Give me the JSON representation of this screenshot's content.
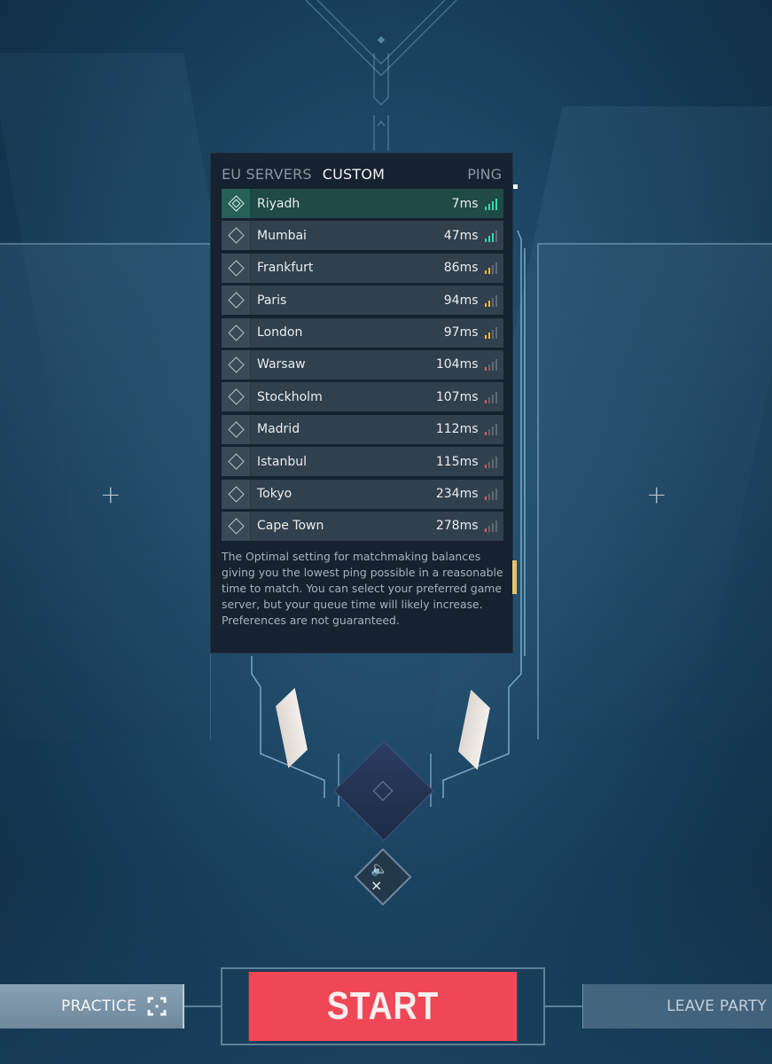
{
  "server_panel": {
    "tabs": [
      {
        "label": "EU SERVERS",
        "active": false
      },
      {
        "label": "CUSTOM",
        "active": true
      }
    ],
    "ping_header": "PING",
    "servers": [
      {
        "city": "Riyadh",
        "ping": "7ms",
        "signal": 4,
        "color": "#38d9b0",
        "selected": true
      },
      {
        "city": "Mumbai",
        "ping": "47ms",
        "signal": 3,
        "color": "#38d9b0",
        "selected": false
      },
      {
        "city": "Frankfurt",
        "ping": "86ms",
        "signal": 2,
        "color": "#e8b84a",
        "selected": false
      },
      {
        "city": "Paris",
        "ping": "94ms",
        "signal": 2,
        "color": "#e8b84a",
        "selected": false
      },
      {
        "city": "London",
        "ping": "97ms",
        "signal": 2,
        "color": "#e8b84a",
        "selected": false
      },
      {
        "city": "Warsaw",
        "ping": "104ms",
        "signal": 1,
        "color": "#e05a5a",
        "selected": false
      },
      {
        "city": "Stockholm",
        "ping": "107ms",
        "signal": 1,
        "color": "#e05a5a",
        "selected": false
      },
      {
        "city": "Madrid",
        "ping": "112ms",
        "signal": 1,
        "color": "#e05a5a",
        "selected": false
      },
      {
        "city": "Istanbul",
        "ping": "115ms",
        "signal": 1,
        "color": "#e05a5a",
        "selected": false
      },
      {
        "city": "Tokyo",
        "ping": "234ms",
        "signal": 1,
        "color": "#e05a5a",
        "selected": false
      },
      {
        "city": "Cape Town",
        "ping": "278ms",
        "signal": 1,
        "color": "#e05a5a",
        "selected": false
      }
    ],
    "description": "The Optimal setting for matchmaking balances giving you the lowest ping possible in a reasonable time to match. You can select your preferred game server, but your queue time will likely increase. Preferences are not guaranteed."
  },
  "party": {
    "left_slot_plus": "+",
    "right_slot_plus": "+"
  },
  "audio": {
    "mute_glyph": "🔈×"
  },
  "footer": {
    "practice_label": "PRACTICE",
    "start_label": "START",
    "leave_label": "LEAVE PARTY"
  },
  "colors": {
    "start": "#f04757",
    "selected_row": "#1f4a45",
    "accent_gold": "#e6c36a"
  }
}
